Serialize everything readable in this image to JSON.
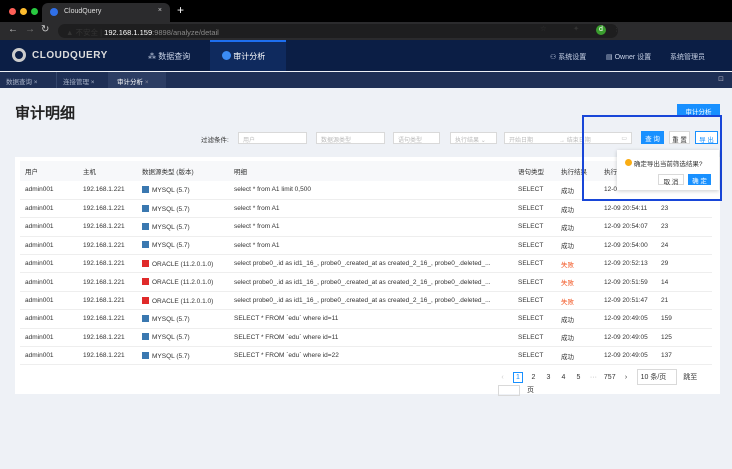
{
  "browser": {
    "tab_title": "CloudQuery",
    "security": "不安全",
    "url_host": "192.168.1.159",
    "url_rest": ":9898/analyze/detail",
    "avatar": "d"
  },
  "app": {
    "logo": "CLOUDQUERY",
    "nav": [
      {
        "label": "数据查询"
      },
      {
        "label": "审计分析"
      }
    ],
    "right": {
      "settings": "系统设置",
      "owner": "Owner 设置",
      "admin": "系统管理员"
    }
  },
  "page_tabs": [
    {
      "label": "数据查询"
    },
    {
      "label": "连接管理"
    },
    {
      "label": "审计分析"
    }
  ],
  "page": {
    "title": "审计明细",
    "audit_button": "审计分析"
  },
  "filter": {
    "label": "过滤条件:",
    "user": "用户",
    "dbtype": "数据源类型",
    "stmt": "语句类型",
    "result": "执行结果",
    "start": "开始日期",
    "end": "结束日期",
    "query": "查 询",
    "reset": "重 置",
    "export": "导 出"
  },
  "popconfirm": {
    "message": "确定导出当前筛选结果?",
    "cancel": "取 消",
    "ok": "确 定"
  },
  "table": {
    "headers": [
      "用户",
      "主机",
      "数据源类型 (版本)",
      "明细",
      "语句类型",
      "执行结果",
      "执行"
    ],
    "rows": [
      [
        "admin001",
        "192.168.1.221",
        "MYSQL (5.7)",
        "select * from A1 limit 0,500",
        "SELECT",
        "成功",
        "12-0",
        ""
      ],
      [
        "admin001",
        "192.168.1.221",
        "MYSQL (5.7)",
        "select * from A1",
        "SELECT",
        "成功",
        "12-09 20:54:11",
        "23"
      ],
      [
        "admin001",
        "192.168.1.221",
        "MYSQL (5.7)",
        "select * from A1",
        "SELECT",
        "成功",
        "12-09 20:54:07",
        "23"
      ],
      [
        "admin001",
        "192.168.1.221",
        "MYSQL (5.7)",
        "select * from A1",
        "SELECT",
        "成功",
        "12-09 20:54:00",
        "24"
      ],
      [
        "admin001",
        "192.168.1.221",
        "ORACLE (11.2.0.1.0)",
        "select probe0_.id as id1_16_, probe0_.created_at as created_2_16_, probe0_.deleted_...",
        "SELECT",
        "失败",
        "12-09 20:52:13",
        "29"
      ],
      [
        "admin001",
        "192.168.1.221",
        "ORACLE (11.2.0.1.0)",
        "select probe0_.id as id1_16_, probe0_.created_at as created_2_16_, probe0_.deleted_...",
        "SELECT",
        "失败",
        "12-09 20:51:59",
        "14"
      ],
      [
        "admin001",
        "192.168.1.221",
        "ORACLE (11.2.0.1.0)",
        "select probe0_.id as id1_16_, probe0_.created_at as created_2_16_, probe0_.deleted_...",
        "SELECT",
        "失败",
        "12-09 20:51:47",
        "21"
      ],
      [
        "admin001",
        "192.168.1.221",
        "MYSQL (5.7)",
        "SELECT * FROM `edu` where id=11",
        "SELECT",
        "成功",
        "12-09 20:49:05",
        "159"
      ],
      [
        "admin001",
        "192.168.1.221",
        "MYSQL (5.7)",
        "SELECT * FROM `edu` where id=11",
        "SELECT",
        "成功",
        "12-09 20:49:05",
        "125"
      ],
      [
        "admin001",
        "192.168.1.221",
        "MYSQL (5.7)",
        "SELECT * FROM `edu` where id=22",
        "SELECT",
        "成功",
        "12-09 20:49:05",
        "137"
      ]
    ]
  },
  "pagination": {
    "pages": [
      "1",
      "2",
      "3",
      "4",
      "5"
    ],
    "ellipsis": "···",
    "last": "757",
    "page_size": "10 条/页",
    "goto": "跳至",
    "page_unit": "页"
  },
  "colors": {
    "primary": "#1890ff",
    "fail": "#f2531f",
    "header": "#0b1e45",
    "highlight": "#1846d8"
  }
}
